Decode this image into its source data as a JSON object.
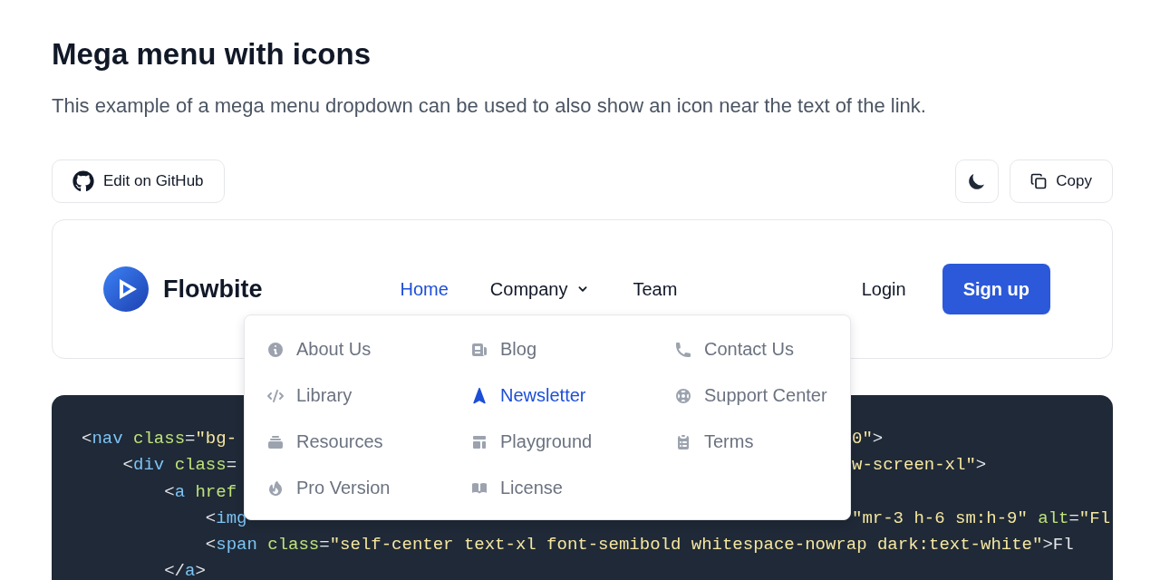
{
  "heading": "Mega menu with icons",
  "description": "This example of a mega menu dropdown can be used to also show an icon near the text of the link.",
  "toolbar": {
    "edit_button": "Edit on GitHub",
    "copy_button": "Copy"
  },
  "preview": {
    "brand": "Flowbite",
    "nav": [
      {
        "label": "Home",
        "selected": true,
        "kind": "link"
      },
      {
        "label": "Company",
        "selected": false,
        "kind": "dropdown"
      },
      {
        "label": "Team",
        "selected": false,
        "kind": "link"
      }
    ],
    "login": "Login",
    "signup": "Sign up",
    "mega_menu": {
      "columns": [
        [
          {
            "label": "About Us",
            "selected": false
          },
          {
            "label": "Library",
            "selected": false
          },
          {
            "label": "Resources",
            "selected": false
          },
          {
            "label": "Pro Version",
            "selected": false
          }
        ],
        [
          {
            "label": "Blog",
            "selected": false
          },
          {
            "label": "Newsletter",
            "selected": true
          },
          {
            "label": "Playground",
            "selected": false
          },
          {
            "label": "License",
            "selected": false
          }
        ],
        [
          {
            "label": "Contact Us",
            "selected": false
          },
          {
            "label": "Support Center",
            "selected": false
          },
          {
            "label": "Terms",
            "selected": false
          }
        ]
      ]
    }
  },
  "code": [
    {
      "left": [
        {
          "kind": "punct",
          "text": "<"
        },
        {
          "kind": "tag",
          "text": "nav"
        },
        {
          "kind": "attr",
          "text": " class"
        },
        {
          "kind": "punct",
          "text": "="
        },
        {
          "kind": "string",
          "text": "\"bg-"
        }
      ],
      "right": [
        {
          "kind": "string",
          "text": "0\""
        },
        {
          "kind": "punct",
          "text": ">"
        }
      ]
    },
    {
      "left": [
        {
          "kind": "punct",
          "text": "    <"
        },
        {
          "kind": "tag",
          "text": "div"
        },
        {
          "kind": "attr",
          "text": " class"
        },
        {
          "kind": "punct",
          "text": "="
        }
      ],
      "right": [
        {
          "kind": "string",
          "text": "w-screen-xl\""
        },
        {
          "kind": "punct",
          "text": ">"
        }
      ]
    },
    {
      "left": [
        {
          "kind": "punct",
          "text": "        <"
        },
        {
          "kind": "tag",
          "text": "a"
        },
        {
          "kind": "attr",
          "text": " href"
        }
      ]
    },
    {
      "left": [
        {
          "kind": "punct",
          "text": "            <"
        },
        {
          "kind": "tag",
          "text": "img"
        }
      ],
      "right": [
        {
          "kind": "string",
          "text": "\"mr-3 h-6 sm:h-9\""
        },
        {
          "kind": "attr",
          "text": " alt"
        },
        {
          "kind": "punct",
          "text": "="
        },
        {
          "kind": "string",
          "text": "\"Fl"
        }
      ]
    },
    {
      "left": [
        {
          "kind": "punct",
          "text": "            <"
        },
        {
          "kind": "tag",
          "text": "span"
        },
        {
          "kind": "attr",
          "text": " class"
        },
        {
          "kind": "punct",
          "text": "="
        },
        {
          "kind": "string",
          "text": "\"self-center text-xl font-semibold whitespace-nowrap dark:text-white\""
        },
        {
          "kind": "punct",
          "text": ">Fl"
        }
      ]
    },
    {
      "left": [
        {
          "kind": "punct",
          "text": "        </"
        },
        {
          "kind": "tag",
          "text": "a"
        },
        {
          "kind": "punct",
          "text": ">"
        }
      ]
    }
  ]
}
